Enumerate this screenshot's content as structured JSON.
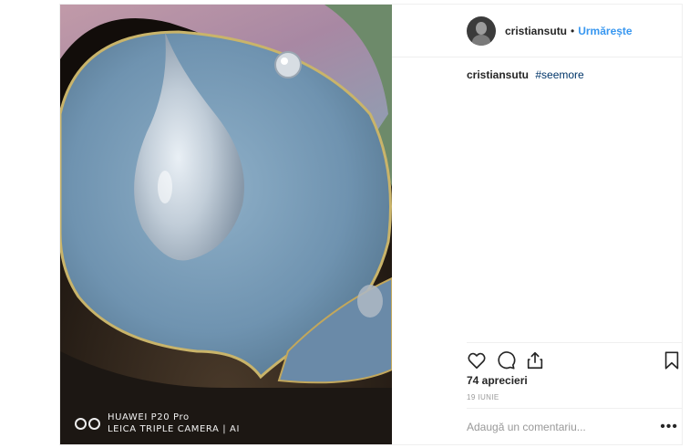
{
  "post": {
    "author": "cristiansutu",
    "separator": "•",
    "follow_label": "Urmărește",
    "caption_user": "cristiansutu",
    "caption_hashtag": "#seemore",
    "likes": "74 aprecieri",
    "date": "19 IUNIE",
    "comment_placeholder": "Adaugă un comentariu...",
    "more_label": "•••"
  },
  "watermark": {
    "line1": "HUAWEI P20 Pro",
    "line2": "LEICA TRIPLE CAMERA | AI"
  },
  "icons": {
    "like": "heart-icon",
    "comment": "comment-icon",
    "share": "share-icon",
    "save": "bookmark-icon"
  },
  "colors": {
    "link": "#3897f0",
    "hashtag": "#003569",
    "muted": "#999999"
  }
}
